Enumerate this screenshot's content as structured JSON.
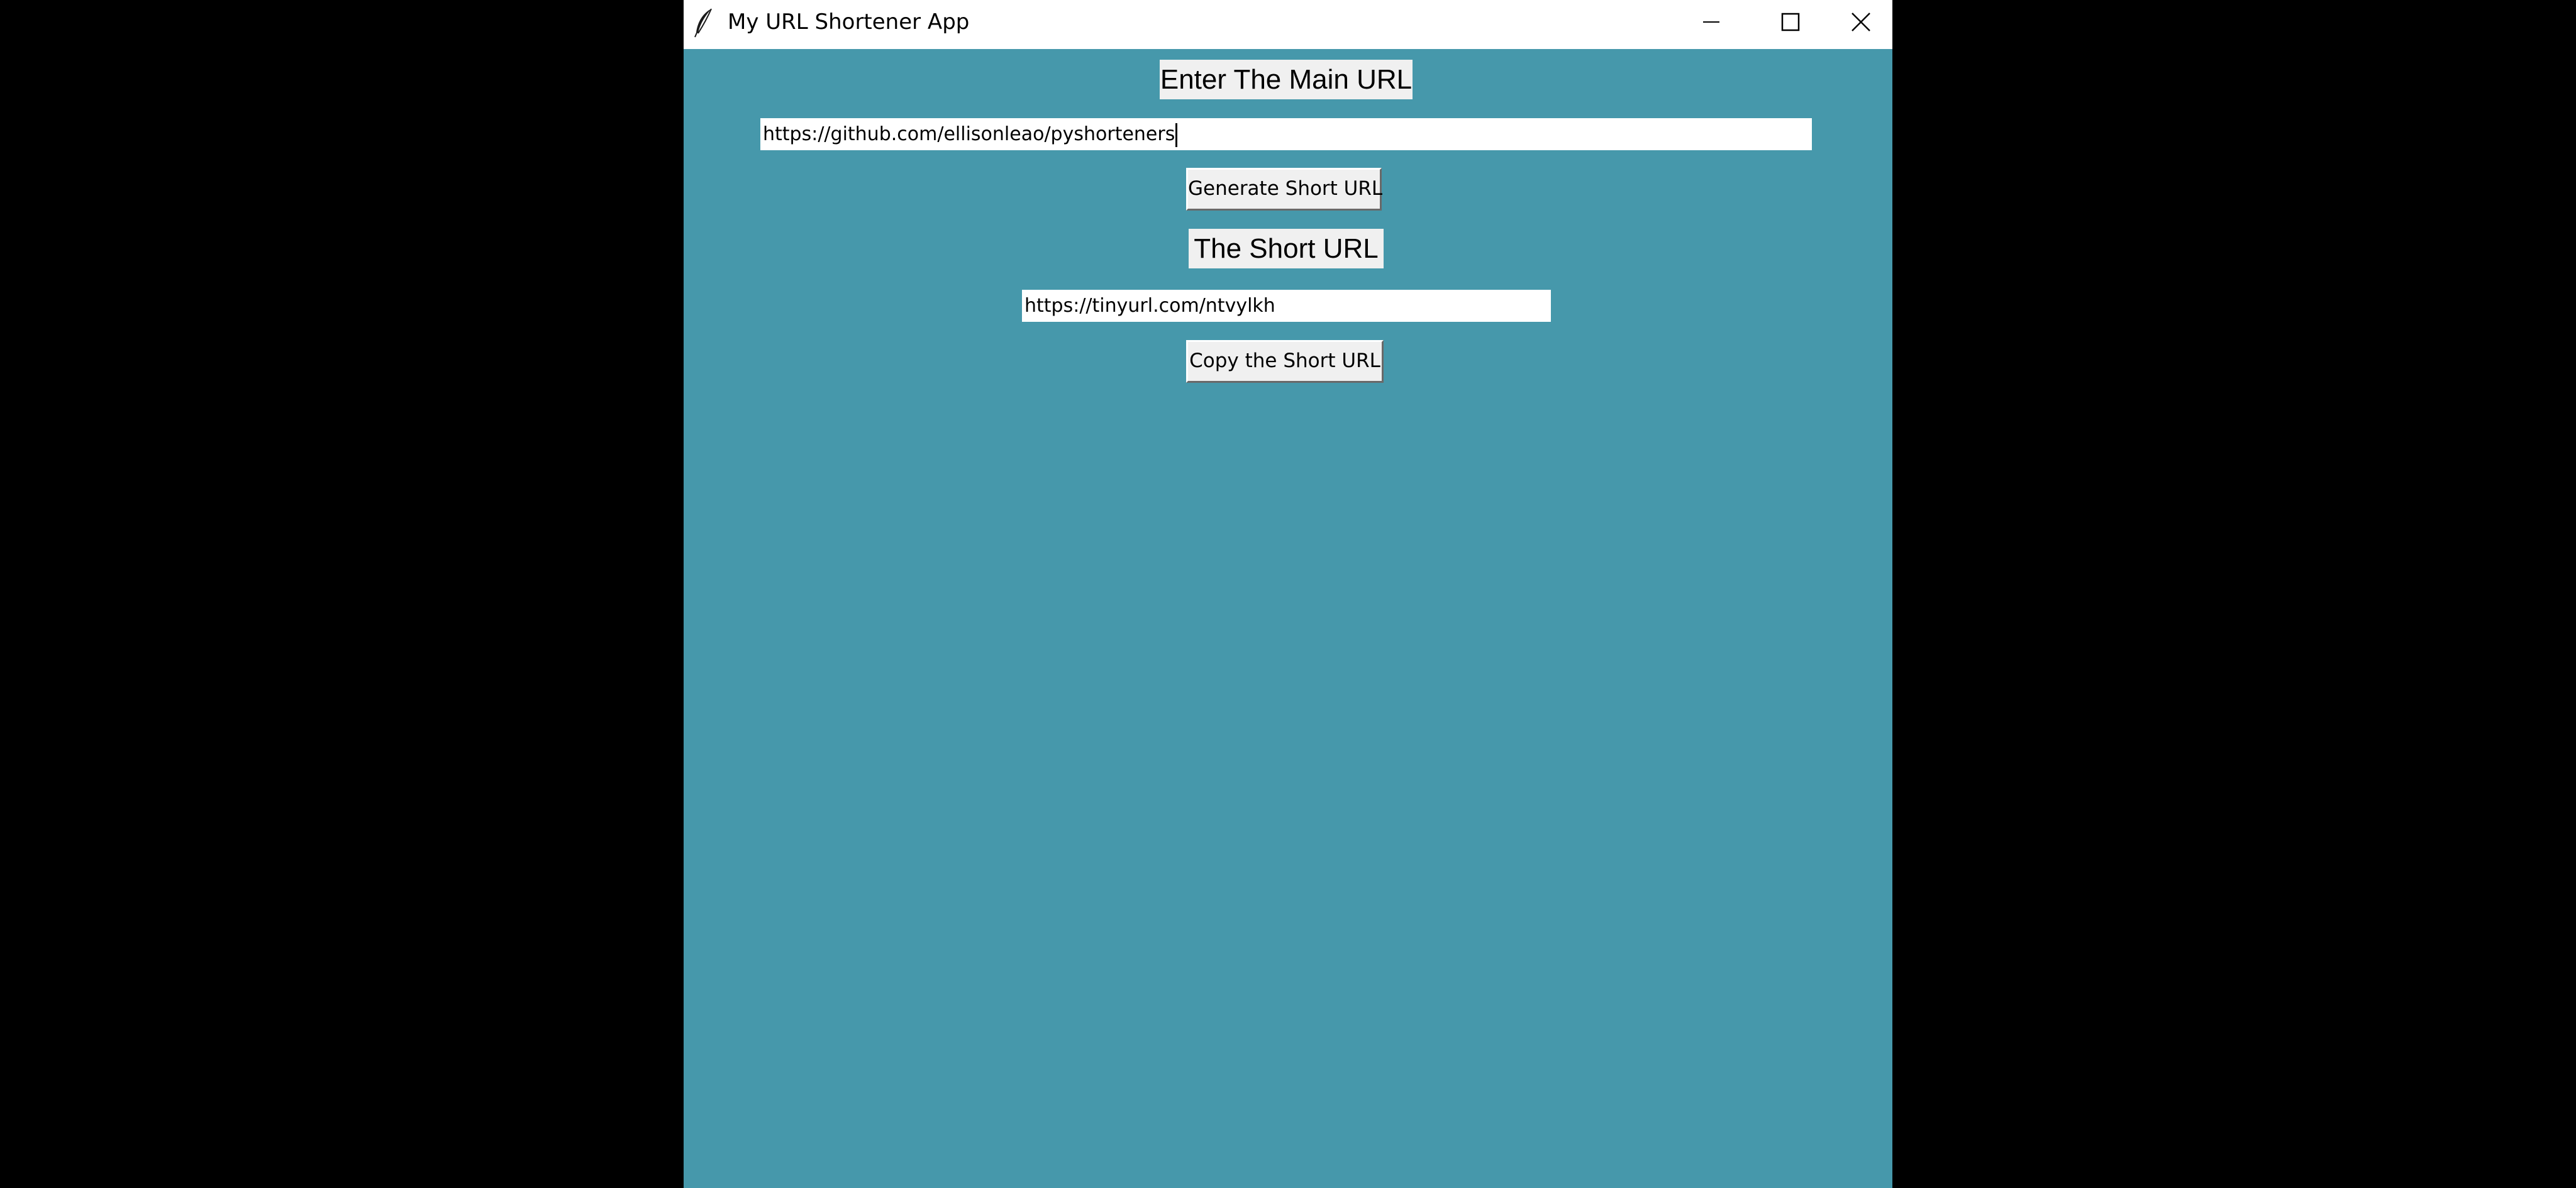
{
  "window": {
    "title": "My URL Shortener App",
    "background_color": "#4698ab"
  },
  "titlebar": {
    "icons": {
      "app": "feather-icon",
      "minimize": "minimize-icon",
      "maximize": "maximize-icon",
      "close": "close-icon"
    }
  },
  "main_url": {
    "label": "Enter The Main URL",
    "value": "https://github.com/ellisonleao/pyshorteners"
  },
  "generate_button": {
    "label": "Generate Short URL"
  },
  "short_url": {
    "label": "The Short URL",
    "value": "https://tinyurl.com/ntvylkh"
  },
  "copy_button": {
    "label": "Copy the Short URL"
  }
}
